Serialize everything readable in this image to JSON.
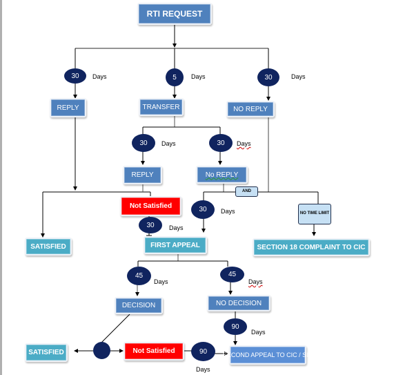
{
  "title": "RTI REQUEST",
  "nodes": {
    "reply_first": "REPLY",
    "transfer": "TRANSFER",
    "no_reply_first": "NO REPLY",
    "reply_second": "REPLY",
    "no_reply_second": "No  REPLY",
    "not_satisfied_first": "Not   Satisfied",
    "and": "AND",
    "no_time_limit": "NO TIME LIMIT",
    "satisfied_first": "SATISFIED",
    "first_appeal": "FIRST APPEAL",
    "section18": "SECTION 18 COMPLAINT TO CIC",
    "decision": "DECISION",
    "no_decision": "NO   DECISION",
    "satisfied_second": "SATISFIED",
    "not_satisfied_second": "Not   Satisfied",
    "second_appeal": "SECOND APPEAL TO CIC / SIC"
  },
  "timers": {
    "reply": "30",
    "transfer": "5",
    "no_reply": "30",
    "transfer_reply": "30",
    "transfer_no_reply": "30",
    "first_appeal_via_no_reply": "30",
    "first_appeal_via_not_satisfied": "30",
    "decision": "45",
    "no_decision": "45",
    "no_decision_to_second": "90",
    "not_satisfied_to_second": "90"
  },
  "days_label": "Days",
  "colors": {
    "box_blue": "#4f81bd",
    "box_teal": "#4bacc6",
    "box_red": "#ff0000",
    "circle_navy": "#10245f",
    "and_fill": "#c6e0f4"
  }
}
